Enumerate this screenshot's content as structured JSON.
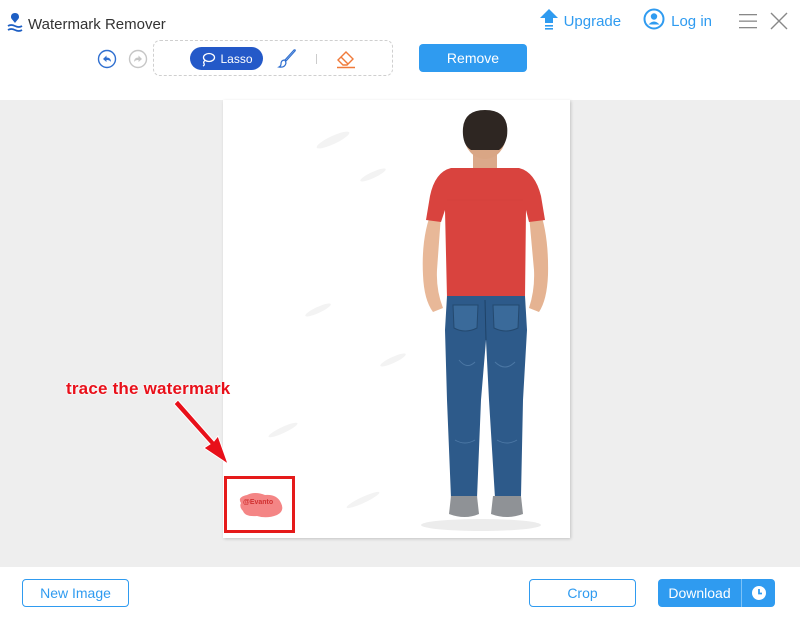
{
  "app": {
    "title": "Watermark Remover",
    "logo_icon": "watermark-drop-icon"
  },
  "header": {
    "upgrade_label": "Upgrade",
    "upgrade_icon": "upload-arrow-icon",
    "login_label": "Log in",
    "login_icon": "user-circle-icon",
    "menu_icon": "hamburger-menu-icon",
    "close_icon": "close-icon"
  },
  "toolbar": {
    "undo_icon": "undo-icon",
    "redo_icon": "redo-icon",
    "tools": [
      {
        "name": "lasso",
        "label": "Lasso",
        "icon": "lasso-icon",
        "active": true
      },
      {
        "name": "brush",
        "label": "",
        "icon": "brush-icon",
        "active": false
      },
      {
        "name": "eraser",
        "label": "",
        "icon": "eraser-icon",
        "active": false
      }
    ],
    "remove_label": "Remove"
  },
  "canvas": {
    "image_description": "Man seen from behind wearing red t-shirt and blue jeans",
    "annotation_text": "trace the watermark",
    "watermark_text": "@Evanto"
  },
  "footer": {
    "new_image_label": "New Image",
    "crop_label": "Crop",
    "download_label": "Download",
    "history_icon": "clock-icon"
  },
  "colors": {
    "accent": "#2f9bf0",
    "lasso_active": "#2459c8",
    "eraser": "#f07a3a",
    "annotation_red": "#e8101a",
    "canvas_bg": "#eeeeee"
  }
}
